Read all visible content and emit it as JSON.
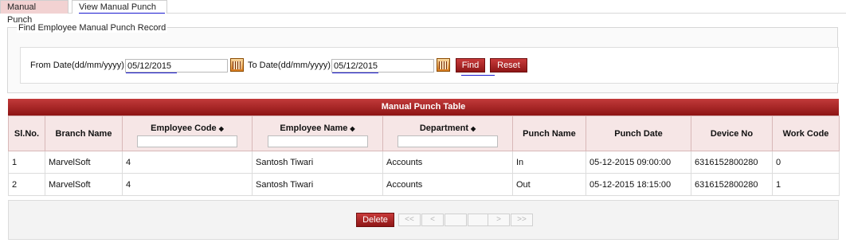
{
  "tabs": [
    {
      "label": "Manual Punch"
    },
    {
      "label": "View Manual Punch"
    }
  ],
  "finder": {
    "legend": "Find Employee Manual Punch Record",
    "from_label": "From Date(dd/mm/yyyy)",
    "from_value": "05/12/2015",
    "to_label": "To Date(dd/mm/yyyy)",
    "to_value": "05/12/2015",
    "find_label": "Find",
    "reset_label": "Reset"
  },
  "table": {
    "title": "Manual Punch Table",
    "columns": [
      {
        "label": "Sl.No."
      },
      {
        "label": "Branch Name"
      },
      {
        "label": "Employee Code"
      },
      {
        "label": "Employee Name"
      },
      {
        "label": "Department"
      },
      {
        "label": "Punch Name"
      },
      {
        "label": "Punch Date"
      },
      {
        "label": "Device No"
      },
      {
        "label": "Work Code"
      }
    ],
    "sort_icon": "sort-arrows-icon",
    "rows": [
      [
        "1",
        "MarvelSoft",
        "4",
        "Santosh Tiwari",
        "Accounts",
        "In",
        "05-12-2015 09:00:00",
        "6316152800280",
        "0"
      ],
      [
        "2",
        "MarvelSoft",
        "4",
        "Santosh Tiwari",
        "Accounts",
        "Out",
        "05-12-2015 18:15:00",
        "6316152800280",
        "1"
      ]
    ]
  },
  "footer": {
    "delete_label": "Delete",
    "pager": {
      "first": "<<",
      "prev": "<",
      "next": ">",
      "last": ">>"
    }
  },
  "colors": {
    "accent": "#a32020",
    "header_bg": "#f6e6e6",
    "link_underline": "#1a1ad0"
  }
}
